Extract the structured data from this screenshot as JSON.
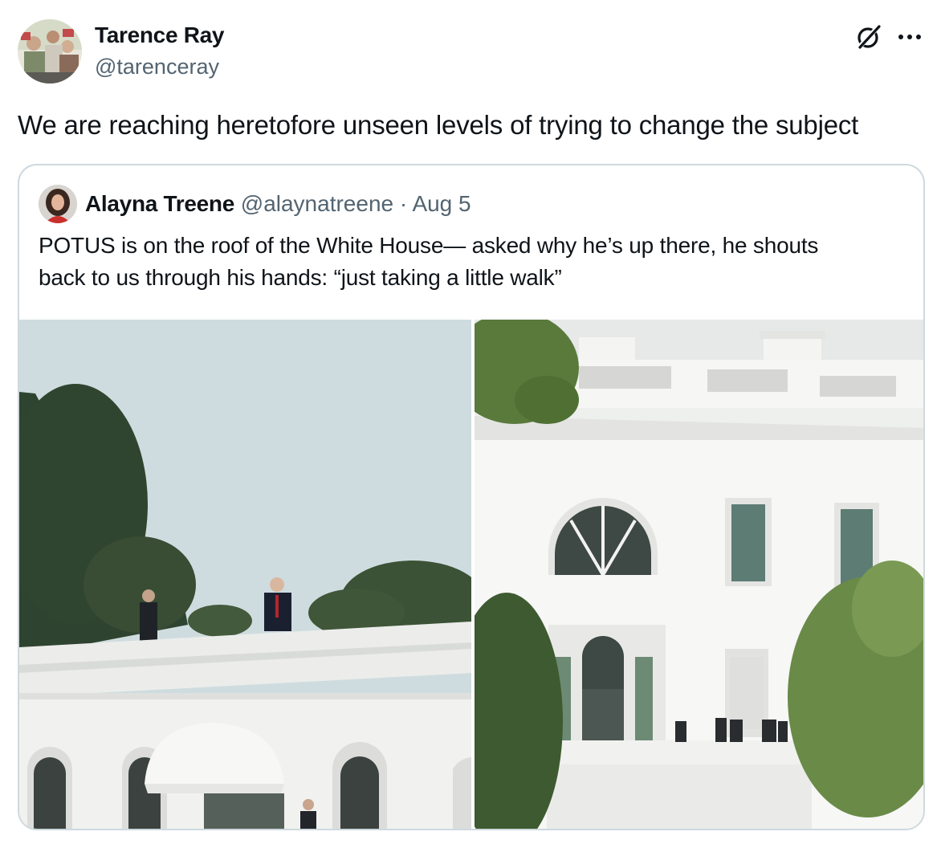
{
  "tweet": {
    "author_name": "Tarence Ray",
    "author_handle": "@tarenceray",
    "text": "We are reaching heretofore unseen levels of trying to change the subject",
    "icons": [
      "grok-icon",
      "more-options-icon"
    ],
    "more_glyph": "···"
  },
  "quoted_tweet": {
    "author_name": "Alayna Treene",
    "author_handle": "@alaynatreene",
    "separator": "·",
    "date": "Aug 5",
    "text_line1": "POTUS is on the roof of the White House— asked why he’s up there, he shouts",
    "text_line2": "back to us through his hands: “just taking a little walk”"
  },
  "colors": {
    "text_primary": "#0f1419",
    "text_secondary": "#536471",
    "border": "#cfd9de",
    "sky_left": "#cfdcdf",
    "building": "#f2f2f0"
  }
}
